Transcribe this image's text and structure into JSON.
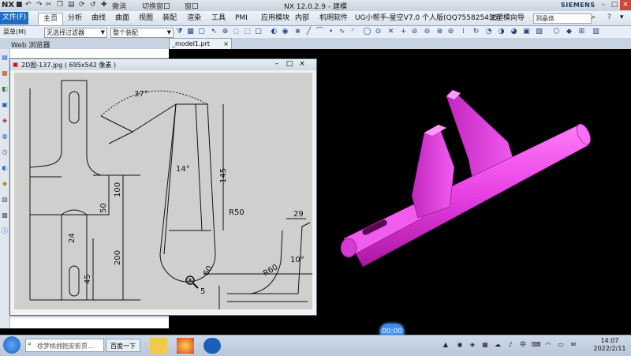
{
  "titlebar": {
    "logo": "NX",
    "title": "NX 12.0.2.9 - 建模",
    "brand": "SIEMENS",
    "quick_access": [
      "撤消",
      "切换窗口",
      "窗口"
    ]
  },
  "menu": {
    "file": "文件(F)",
    "tabs": [
      "主页",
      "分析",
      "曲线",
      "曲面",
      "视图",
      "装配",
      "渲染",
      "工具",
      "PMI",
      "应用模块",
      "内部",
      "机明软件",
      "UG小帮手-星空V7.0 个人版(QQ755825435)",
      "注塑模向导"
    ],
    "active_index": 0,
    "command_search_placeholder": "测晶体"
  },
  "toolbar": {
    "menu_label": "菜单(M)",
    "filter_select": "无选择过滤器",
    "assembly_select": "整个装配"
  },
  "tabs": {
    "web_browser": "Web 浏览器",
    "model_file": "_model1.prt",
    "close": "×"
  },
  "viewer": {
    "title": "2D图-137.jpg ( 695x542 像素 )",
    "dims": {
      "angle37": "37°",
      "angle14": "14°",
      "angle10": "10°",
      "d145": "145",
      "r50": "R50",
      "phi60": "60",
      "r60": "R60",
      "d29": "29",
      "d100": "100",
      "d50": "50",
      "d200": "200",
      "d24": "24",
      "d45": "45",
      "d5": "5"
    }
  },
  "status": {
    "time_pill": "00:00"
  },
  "taskbar": {
    "search_placeholder": "徐梦桃拥抱安影贾...",
    "search_button": "百度一下",
    "time": "14:07",
    "date": "2022/2/11"
  },
  "colors": {
    "model": "#e63fe3",
    "accent": "#1f6cc4",
    "graphics_bg": "#000000"
  }
}
